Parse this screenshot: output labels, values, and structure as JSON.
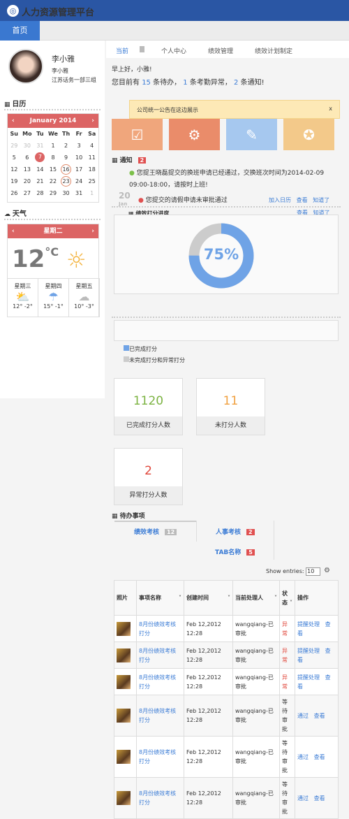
{
  "app": {
    "title": "人力资源管理平台",
    "home": "首页"
  },
  "user": {
    "name": "李小雅",
    "sub_name": "李小雅",
    "dept": "江苏话务一部三组"
  },
  "calendar": {
    "title": "日历",
    "month": "January 2014",
    "weekdays": [
      "Su",
      "Mo",
      "Tu",
      "We",
      "Th",
      "Fr",
      "Sa"
    ],
    "days": [
      [
        "29",
        "30",
        "31",
        "1",
        "2",
        "3",
        "4"
      ],
      [
        "5",
        "6",
        "7",
        "8",
        "9",
        "10",
        "11"
      ],
      [
        "12",
        "13",
        "14",
        "15",
        "16",
        "17",
        "18"
      ],
      [
        "19",
        "20",
        "21",
        "22",
        "23",
        "24",
        "25"
      ],
      [
        "26",
        "27",
        "28",
        "29",
        "30",
        "31",
        "1"
      ]
    ]
  },
  "weather": {
    "title": "天气",
    "day": "星期二",
    "temp": "12",
    "unit": "°C",
    "forecast": [
      {
        "day": "星期三",
        "range": "12° -2°"
      },
      {
        "day": "星期四",
        "range": "15° -1°"
      },
      {
        "day": "星期五",
        "range": "10° -3°"
      }
    ]
  },
  "tabs": [
    "当前",
    "个人中心",
    "绩效管理",
    "绩效计划制定"
  ],
  "greeting": "早上好，小雅!",
  "summary": {
    "p1": "您目前有",
    "n1": "15",
    "p2": "条待办，",
    "n2": "1",
    "p3": "条考勤异常，",
    "n3": "2",
    "p4": "条通知!"
  },
  "announcement": {
    "text": "公司统一公告在这边展示",
    "close": "x"
  },
  "notice": {
    "title": "通知",
    "count": "2",
    "date_day": "20",
    "date_mon": "Jan",
    "items": [
      {
        "text": "您提王晓磊提交的换班申请已经通过，交换班次时间为2014-02-09 09:00-18:00，请按时上班!"
      },
      {
        "text": "您提交的请假申请未审批通过"
      }
    ],
    "actions": [
      "加入日历",
      "查看",
      "知道了"
    ]
  },
  "progress": {
    "title": "绩效打分进度",
    "actions": [
      "查看",
      "知道了"
    ],
    "percent_label": "75%",
    "percent": 75,
    "legend": [
      "已完成打分",
      "未完成打分和异常打分"
    ],
    "colors": {
      "done": "#6fa3e6",
      "rest": "#cccccc"
    }
  },
  "stats": [
    {
      "value": "1120",
      "label": "已完成打分人数",
      "color": "#7cb342"
    },
    {
      "value": "11",
      "label": "未打分人数",
      "color": "#f0a040"
    },
    {
      "value": "2",
      "label": "异常打分人数",
      "color": "#e0463a"
    }
  ],
  "todo": {
    "title": "待办事项",
    "tabs": [
      {
        "label": "绩效考核",
        "count": "12"
      },
      {
        "label": "人事考核",
        "count": "2"
      },
      {
        "label": "TAB名称",
        "count": "5"
      }
    ],
    "show_entries": "Show entries:",
    "entries": "10",
    "headers": [
      "照片",
      "事项名称",
      "创建时间",
      "当前处理人",
      "状态",
      "操作"
    ],
    "rows": [
      {
        "name": "8月份绩效考核打分",
        "time": "Feb 12,2012 12:28",
        "handler": "wangqiang-已审批",
        "status": "异常",
        "ops": [
          "提醒处理",
          "查看"
        ]
      },
      {
        "name": "8月份绩效考核打分",
        "time": "Feb 12,2012 12:28",
        "handler": "wangqiang-已审批",
        "status": "异常",
        "ops": [
          "提醒处理",
          "查看"
        ]
      },
      {
        "name": "8月份绩效考核打分",
        "time": "Feb 12,2012 12:28",
        "handler": "wangqiang-已审批",
        "status": "异常",
        "ops": [
          "提醒处理",
          "查看"
        ]
      },
      {
        "name": "8月份绩效考核打分",
        "time": "Feb 12,2012 12:28",
        "handler": "wangqiang-已审批",
        "status": "等待审批",
        "ops": [
          "通过",
          "查看"
        ]
      },
      {
        "name": "8月份绩效考核打分",
        "time": "Feb 12,2012 12:28",
        "handler": "wangqiang-已审批",
        "status": "等待审批",
        "ops": [
          "通过",
          "查看"
        ]
      },
      {
        "name": "8月份绩效考核打分",
        "time": "Feb 12,2012 12:28",
        "handler": "wangqiang-已审批",
        "status": "等待审批",
        "ops": [
          "通过",
          "查看"
        ]
      }
    ]
  }
}
